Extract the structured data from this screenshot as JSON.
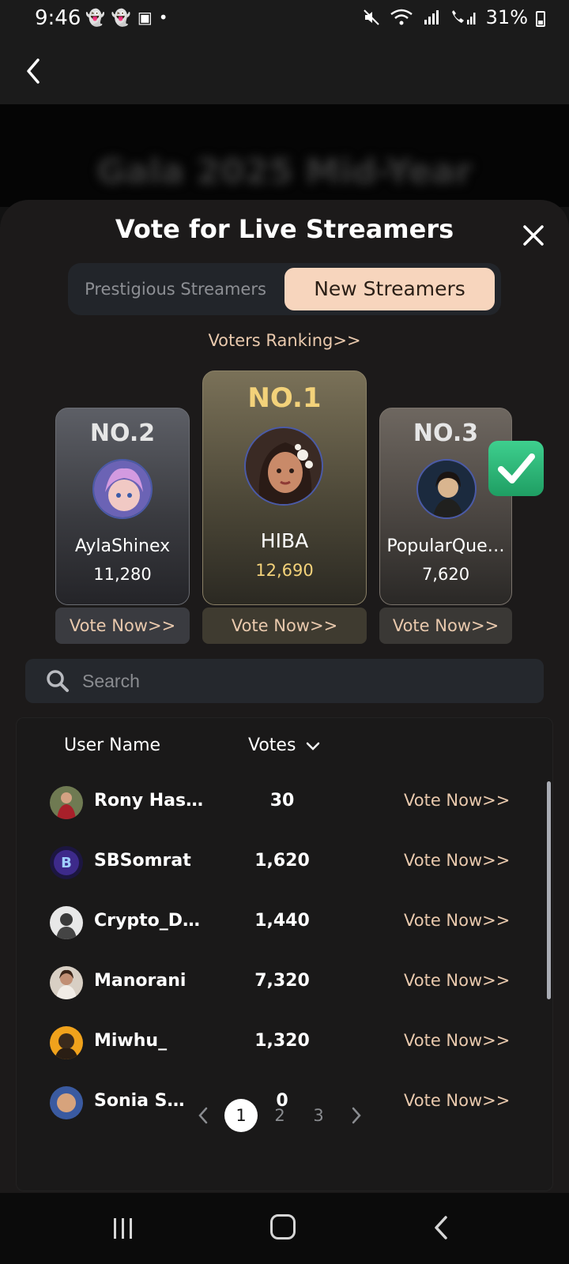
{
  "status": {
    "time": "9:46",
    "battery": "31%"
  },
  "background": {
    "title": "Gala 2025 Mid-Year"
  },
  "sheet": {
    "title": "Vote for Live Streamers",
    "tabs": [
      {
        "label": "Prestigious Streamers",
        "active": false
      },
      {
        "label": "New Streamers",
        "active": true
      }
    ],
    "voters_ranking": "Voters Ranking>>"
  },
  "podium": {
    "first": {
      "rank": "NO.1",
      "name": "HIBA",
      "votes": "12,690",
      "vote_label": "Vote Now>>"
    },
    "second": {
      "rank": "NO.2",
      "name": "AylaShinex",
      "votes": "11,280",
      "vote_label": "Vote Now>>"
    },
    "third": {
      "rank": "NO.3",
      "name": "PopularQue…",
      "votes": "7,620",
      "vote_label": "Vote Now>>"
    }
  },
  "search": {
    "placeholder": "Search"
  },
  "table": {
    "headers": {
      "user": "User Name",
      "votes": "Votes"
    },
    "rows": [
      {
        "name": "Rony Has…",
        "votes": "30",
        "action": "Vote Now>>"
      },
      {
        "name": "SBSomrat",
        "votes": "1,620",
        "action": "Vote Now>>"
      },
      {
        "name": "Crypto_D…",
        "votes": "1,440",
        "action": "Vote Now>>"
      },
      {
        "name": "Manorani",
        "votes": "7,320",
        "action": "Vote Now>>"
      },
      {
        "name": "Miwhu_",
        "votes": "1,320",
        "action": "Vote Now>>"
      },
      {
        "name": "Sonia S…",
        "votes": "0",
        "action": "Vote Now>>"
      }
    ]
  },
  "pagination": {
    "pages": [
      "1",
      "2",
      "3"
    ],
    "current": 1
  },
  "colors": {
    "accent": "#f7d5bd",
    "gold": "#f3d27a",
    "vote_link": "#e9c9ad",
    "sheet_bg": "#1c1a1a"
  }
}
